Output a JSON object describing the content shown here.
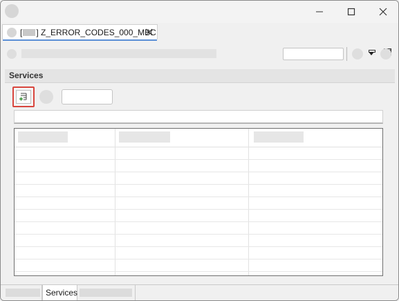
{
  "window": {
    "controls": [
      "minimize-icon",
      "maximize-icon",
      "close-icon"
    ]
  },
  "editor_tab": {
    "bracket_open": "[",
    "title": "] Z_ERROR_CODES_000_MBC",
    "close_icon": "close-icon"
  },
  "section": {
    "title": "Services"
  },
  "toolbar": {
    "add_icon": "add-list-item-icon"
  },
  "bottom_tabs": {
    "active_label": "Services"
  },
  "colors": {
    "highlight_border": "#d8453d",
    "tab_underline": "#5b8fd6"
  }
}
